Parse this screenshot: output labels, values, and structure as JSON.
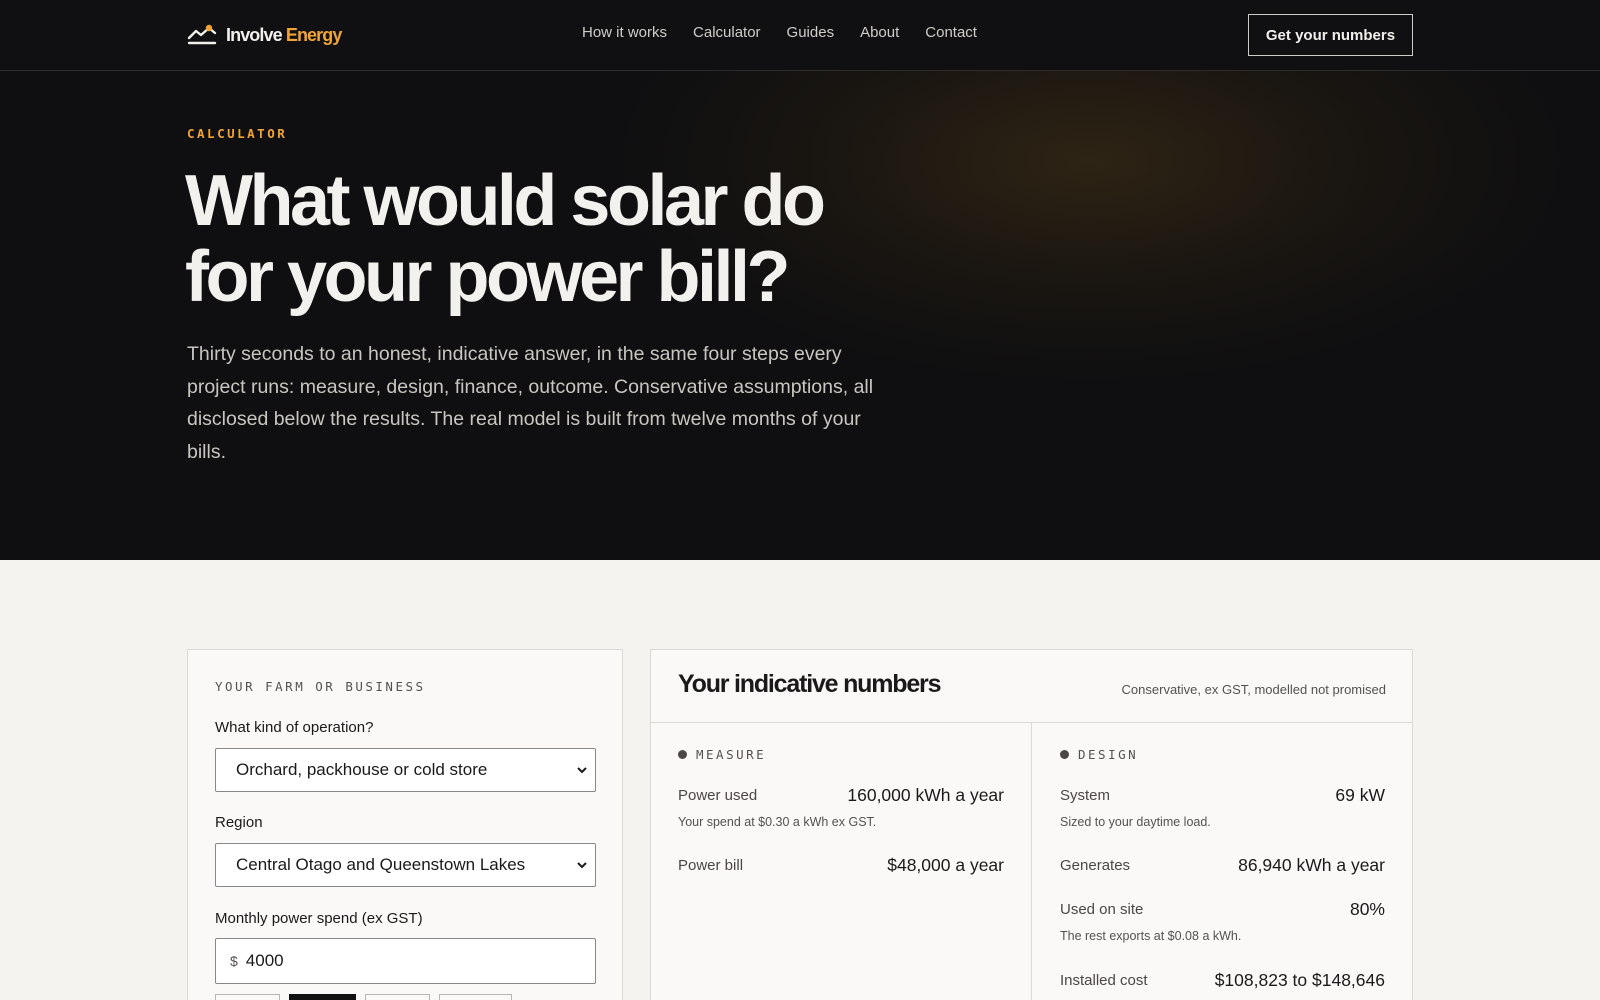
{
  "nav": {
    "logo_primary": "Involve",
    "logo_accent": "Energy",
    "links": [
      "How it works",
      "Calculator",
      "Guides",
      "About",
      "Contact"
    ],
    "cta": "Get your numbers"
  },
  "hero": {
    "eyebrow": "CALCULATOR",
    "title_line1": "What would solar do",
    "title_line2": "for your power bill?",
    "lead": "Thirty seconds to an honest, indicative answer, in the same four steps every project runs: measure, design, finance, outcome. Conservative assumptions, all disclosed below the results. The real model is built from twelve months of your bills."
  },
  "form": {
    "section_label": "YOUR FARM OR BUSINESS",
    "operation_label": "What kind of operation?",
    "operation_value": "Orchard, packhouse or cold store",
    "region_label": "Region",
    "region_value": "Central Otago and Queenstown Lakes",
    "spend_label": "Monthly power spend (ex GST)",
    "spend_currency": "$",
    "spend_value": "4000"
  },
  "results": {
    "title": "Your indicative numbers",
    "note": "Conservative, ex GST, modelled not promised",
    "measure": {
      "heading": "MEASURE",
      "power_used_label": "Power used",
      "power_used_value": "160,000 kWh a year",
      "power_used_sub": "Your spend at $0.30 a kWh ex GST.",
      "bill_label": "Power bill",
      "bill_value": "$48,000 a year"
    },
    "design": {
      "heading": "DESIGN",
      "system_label": "System",
      "system_value": "69 kW",
      "system_sub": "Sized to your daytime load.",
      "generates_label": "Generates",
      "generates_value": "86,940 kWh a year",
      "onsite_label": "Used on site",
      "onsite_value": "80%",
      "onsite_sub": "The rest exports at $0.08 a kWh.",
      "cost_label": "Installed cost",
      "cost_value": "$108,823 to $148,646"
    }
  },
  "colors": {
    "accent": "#f0a437",
    "dark": "#101012",
    "paper": "#f5f3f0"
  }
}
